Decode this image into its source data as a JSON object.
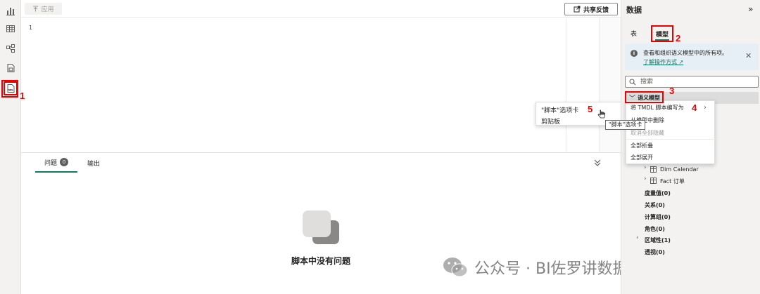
{
  "toolbar": {
    "apply_label": "应用",
    "share_label": "共享反馈"
  },
  "editor": {
    "line_number": "1"
  },
  "context_left": {
    "items": [
      "\"脚本\"选项卡",
      "剪贴板"
    ],
    "tooltip": "\"脚本\"选项卡"
  },
  "bottom": {
    "tab_issues": "问题",
    "issues_count": "0",
    "tab_output": "输出",
    "empty_message": "脚本中没有问题"
  },
  "watermark": "公众号 · BI佐罗讲数据分析",
  "right_pane": {
    "title": "数据",
    "tab_table": "表",
    "tab_model": "模型",
    "info_text": "查看和组织语义模型中的所有项。",
    "info_link": "了解操作方式",
    "search_placeholder": "搜索",
    "tree_root": "语义模型",
    "tables": [
      "Dim Calendar",
      "Fact 订单"
    ],
    "sections": [
      "度量值(0)",
      "关系(0)",
      "计算组(0)",
      "角色(0)",
      "区域性(1)",
      "透视(0)"
    ]
  },
  "context_right": {
    "items": [
      "将 TMDL 脚本编写为",
      "从模型中删除",
      "取消全部隐藏",
      "全部折叠",
      "全部展开"
    ]
  },
  "annotations": [
    "1",
    "2",
    "3",
    "4",
    "5"
  ],
  "colors": {
    "accent": "#117865",
    "annotation": "#e00000"
  }
}
